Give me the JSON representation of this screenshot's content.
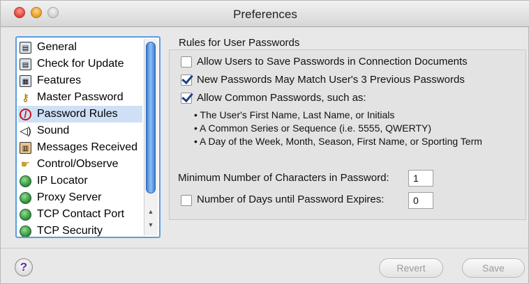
{
  "window": {
    "title": "Preferences"
  },
  "sidebar": {
    "items": [
      {
        "label": "General",
        "icon": "window-icon"
      },
      {
        "label": "Check for Update",
        "icon": "window-icon"
      },
      {
        "label": "Features",
        "icon": "window-icon"
      },
      {
        "label": "Master Password",
        "icon": "key-icon"
      },
      {
        "label": "Password Rules",
        "icon": "prohibited-icon",
        "selected": true
      },
      {
        "label": "Sound",
        "icon": "speaker-icon"
      },
      {
        "label": "Messages Received",
        "icon": "message-icon"
      },
      {
        "label": "Control/Observe",
        "icon": "hand-icon"
      },
      {
        "label": "IP Locator",
        "icon": "globe-icon"
      },
      {
        "label": "Proxy Server",
        "icon": "globe-icon"
      },
      {
        "label": "TCP Contact Port",
        "icon": "globe-icon"
      },
      {
        "label": "TCP Security",
        "icon": "globe-icon"
      }
    ]
  },
  "main": {
    "section_title": "Rules for User Passwords",
    "options": [
      {
        "label": "Allow Users to Save Passwords in Connection Documents",
        "checked": false
      },
      {
        "label": "New Passwords May Match User's 3 Previous Passwords",
        "checked": true
      },
      {
        "label": "Allow Common Passwords, such as:",
        "checked": true
      }
    ],
    "bullets": [
      "• The User's First Name, Last Name, or Initials",
      "• A Common Series or Sequence (i.e. 5555, QWERTY)",
      "• A Day of the Week, Month, Season, First Name, or Sporting Term"
    ],
    "min_chars_label": "Minimum Number of Characters in Password:",
    "min_chars_value": "1",
    "expire_label": "Number of Days until Password Expires:",
    "expire_checked": false,
    "expire_value": "0"
  },
  "footer": {
    "help_label": "?",
    "revert_label": "Revert",
    "save_label": "Save"
  }
}
